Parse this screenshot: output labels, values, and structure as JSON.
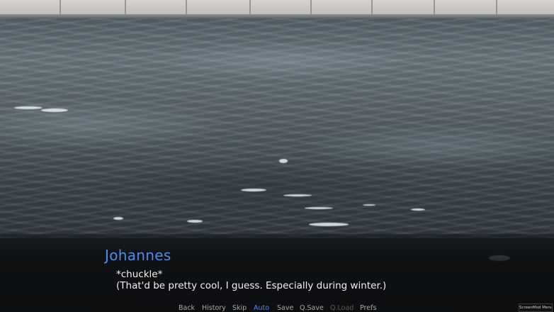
{
  "dialogue": {
    "speaker": "Johannes",
    "speaker_color": "#4a8cf0",
    "lines": [
      "*chuckle*",
      "(That'd be pretty cool, I guess. Especially during winter.)"
    ]
  },
  "quick_menu": {
    "items": [
      {
        "label": "Back",
        "state": "normal"
      },
      {
        "label": "History",
        "state": "normal"
      },
      {
        "label": "Skip",
        "state": "normal"
      },
      {
        "label": "Auto",
        "state": "active"
      },
      {
        "label": "Save",
        "state": "normal"
      },
      {
        "label": "Q.Save",
        "state": "normal"
      },
      {
        "label": "Q.Load",
        "state": "disabled"
      },
      {
        "label": "Prefs",
        "state": "normal"
      }
    ]
  },
  "mod_menu": {
    "label": "ScreenMod Menu"
  },
  "scene": {
    "description_icon": "pool-water-background"
  }
}
